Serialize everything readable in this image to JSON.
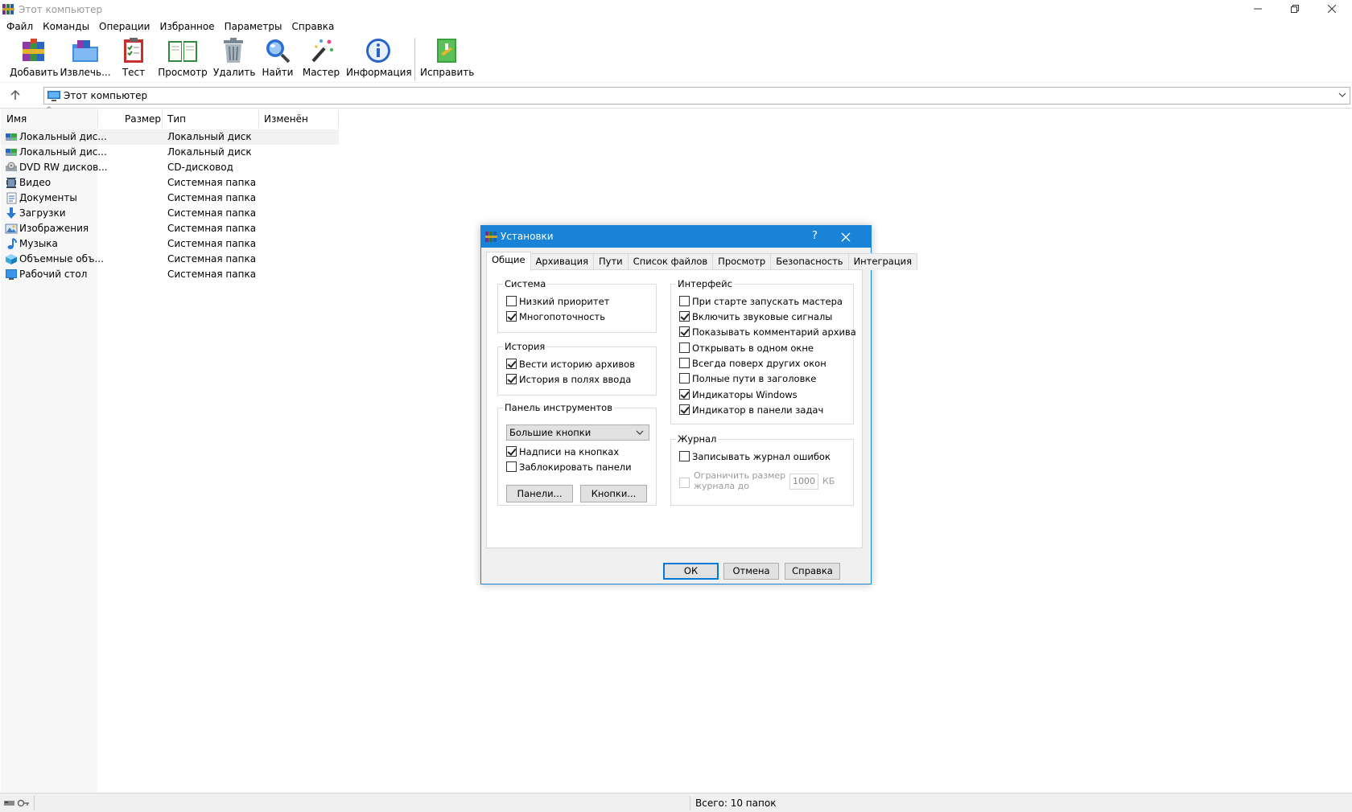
{
  "window": {
    "title": "Этот компьютер"
  },
  "menu": [
    "Файл",
    "Команды",
    "Операции",
    "Избранное",
    "Параметры",
    "Справка"
  ],
  "toolbar": [
    {
      "label": "Добавить",
      "icon": "add-archive-icon"
    },
    {
      "label": "Извлечь...",
      "icon": "extract-folder-icon"
    },
    {
      "label": "Тест",
      "icon": "test-clipboard-icon"
    },
    {
      "label": "Просмотр",
      "icon": "view-book-icon"
    },
    {
      "label": "Удалить",
      "icon": "trash-icon"
    },
    {
      "label": "Найти",
      "icon": "magnifier-icon"
    },
    {
      "label": "Мастер",
      "icon": "wizard-wand-icon"
    },
    {
      "label": "Информация",
      "icon": "info-icon"
    },
    {
      "label": "Исправить",
      "icon": "repair-kit-icon"
    }
  ],
  "address": {
    "value": "Этот компьютер"
  },
  "columns": [
    "Имя",
    "Размер",
    "Тип",
    "Изменён"
  ],
  "files": [
    {
      "name": "Локальный дис...",
      "type": "Локальный диск",
      "icon": "local-disk-icon"
    },
    {
      "name": "Локальный дис...",
      "type": "Локальный диск",
      "icon": "local-disk-icon"
    },
    {
      "name": "DVD RW дисков...",
      "type": "CD-дисковод",
      "icon": "dvd-drive-icon"
    },
    {
      "name": "Видео",
      "type": "Системная папка",
      "icon": "video-folder-icon"
    },
    {
      "name": "Документы",
      "type": "Системная папка",
      "icon": "documents-folder-icon"
    },
    {
      "name": "Загрузки",
      "type": "Системная папка",
      "icon": "downloads-folder-icon"
    },
    {
      "name": "Изображения",
      "type": "Системная папка",
      "icon": "pictures-folder-icon"
    },
    {
      "name": "Музыка",
      "type": "Системная папка",
      "icon": "music-folder-icon"
    },
    {
      "name": "Объемные объ...",
      "type": "Системная папка",
      "icon": "3d-objects-folder-icon"
    },
    {
      "name": "Рабочий стол",
      "type": "Системная папка",
      "icon": "desktop-folder-icon"
    }
  ],
  "status": {
    "summary": "Всего: 10 папок"
  },
  "dialog": {
    "title": "Установки",
    "help": "?",
    "tabs": [
      "Общие",
      "Архивация",
      "Пути",
      "Список файлов",
      "Просмотр",
      "Безопасность",
      "Интеграция"
    ],
    "active_tab": "Общие",
    "system": {
      "title": "Система",
      "items": [
        {
          "label": "Низкий приоритет",
          "checked": false
        },
        {
          "label": "Многопоточность",
          "checked": true
        }
      ]
    },
    "history": {
      "title": "История",
      "items": [
        {
          "label": "Вести историю архивов",
          "checked": true
        },
        {
          "label": "История в полях ввода",
          "checked": true
        }
      ]
    },
    "toolbar_group": {
      "title": "Панель инструментов",
      "select_value": "Большие кнопки",
      "items": [
        {
          "label": "Надписи на кнопках",
          "checked": true
        },
        {
          "label": "Заблокировать панели",
          "checked": false
        }
      ],
      "panels_button": "Панели...",
      "buttons_button": "Кнопки..."
    },
    "interface": {
      "title": "Интерфейс",
      "items": [
        {
          "label": "При старте запускать мастера",
          "checked": false
        },
        {
          "label": "Включить звуковые сигналы",
          "checked": true
        },
        {
          "label": "Показывать комментарий архива",
          "checked": true
        },
        {
          "label": "Открывать в одном окне",
          "checked": false
        },
        {
          "label": "Всегда поверх других окон",
          "checked": false
        },
        {
          "label": "Полные пути в заголовке",
          "checked": false
        },
        {
          "label": "Индикаторы Windows",
          "checked": true
        },
        {
          "label": "Индикатор в панели задач",
          "checked": true
        }
      ]
    },
    "journal": {
      "title": "Журнал",
      "items": [
        {
          "label": "Записывать журнал ошибок",
          "checked": false
        }
      ],
      "limit_line1": "Ограничить размер",
      "limit_line2": "журнала до",
      "limit_value": "1000",
      "limit_unit": "КБ",
      "limit_enabled": false
    },
    "buttons": {
      "ok": "ОК",
      "cancel": "Отмена",
      "help": "Справка"
    }
  }
}
